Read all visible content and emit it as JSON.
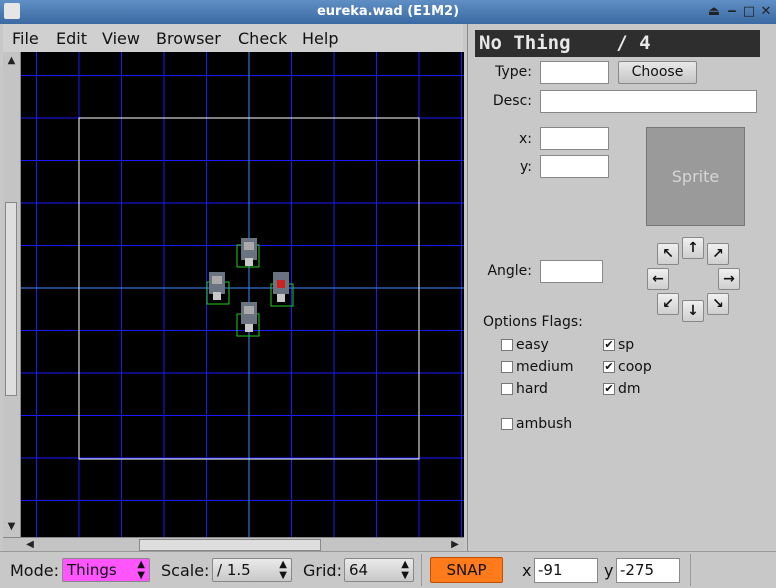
{
  "window": {
    "title": "eureka.wad (E1M2)"
  },
  "menu": [
    "File",
    "Edit",
    "View",
    "Browser",
    "Check",
    "Help"
  ],
  "thing": {
    "header": "No Thing    / 4",
    "type_label": "Type:",
    "type_value": "",
    "choose_label": "Choose",
    "desc_label": "Desc:",
    "desc_value": "",
    "x_label": "x:",
    "x_value": "",
    "y_label": "y:",
    "y_value": "",
    "sprite_label": "Sprite",
    "angle_label": "Angle:",
    "angle_value": "",
    "options_label": "Options Flags:",
    "flags": [
      {
        "label": "easy",
        "checked": false
      },
      {
        "label": "medium",
        "checked": false
      },
      {
        "label": "hard",
        "checked": false
      },
      {
        "label": "sp",
        "checked": true
      },
      {
        "label": "coop",
        "checked": true
      },
      {
        "label": "dm",
        "checked": true
      },
      {
        "label": "ambush",
        "checked": false
      }
    ]
  },
  "status": {
    "mode_label": "Mode:",
    "mode_value": "Things",
    "scale_label": "Scale:",
    "scale_value": "/ 1.5",
    "grid_label": "Grid:",
    "grid_value": "64",
    "snap_label": "SNAP",
    "x_label": "x",
    "x_value": "-91",
    "y_label": "y",
    "y_value": "-275"
  },
  "colors": {
    "grid": "#1a1aff",
    "grid_axis": "#3c8cff",
    "map_bg": "#000000",
    "room_outline": "#ffffff",
    "mode_select": "#ff55ff",
    "snap_button": "#ff7a1a",
    "thing_marker": "#22cc22",
    "header_bg": "#2e2e2e"
  },
  "icons": {
    "angle_buttons": [
      "arrow-nw-icon",
      "arrow-n-icon",
      "arrow-ne-icon",
      "arrow-w-icon",
      "arrow-e-icon",
      "arrow-sw-icon",
      "arrow-s-icon",
      "arrow-se-icon"
    ]
  }
}
